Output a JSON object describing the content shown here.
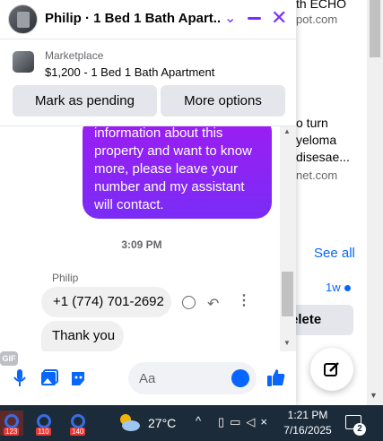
{
  "chat": {
    "title": "Philip · 1 Bed 1 Bath Apart...",
    "marketplace_label": "Marketplace",
    "listing": "$1,200 - 1 Bed 1 Bath Apartment",
    "mark_pending": "Mark as pending",
    "more_options": "More options",
    "outgoing_message": "information about this\nproperty and want to know\nmore, please leave your\nnumber and my assistant\nwill contact.",
    "timestamp": "3:09 PM",
    "sender": "Philip",
    "incoming_messages": [
      "+1 (774) 701-2692",
      "Thank you"
    ],
    "input_placeholder": "Aa",
    "gif_label": "GIF"
  },
  "background": {
    "title_fragment": "th ECHO",
    "url_fragment": "pot.com",
    "article_fragment": "o turn\nyeloma\ndisesae...",
    "url2_fragment": "net.com",
    "see_all": "See all",
    "time_ago": "1w",
    "delete_label": "elete"
  },
  "taskbar": {
    "apps": [
      {
        "name": "app-1",
        "badge": "123"
      },
      {
        "name": "app-2",
        "badge": "110"
      },
      {
        "name": "app-3",
        "badge": "140"
      }
    ],
    "temperature": "27°C",
    "time": "1:21 PM",
    "date": "7/16/2025",
    "notifications": "2"
  },
  "colors": {
    "accent": "#7b2cff",
    "bubble_start": "#9d1cf2",
    "bubble_end": "#7a2cf6",
    "link": "#0866ff"
  }
}
